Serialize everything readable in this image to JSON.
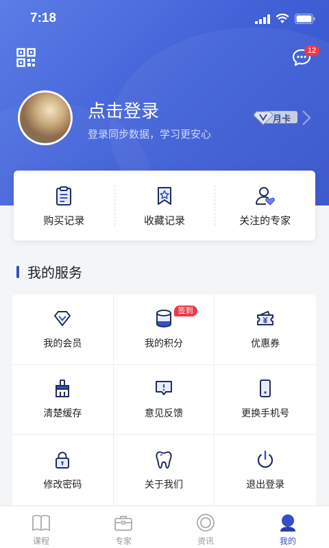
{
  "status_bar": {
    "time": "7:18"
  },
  "header": {
    "message_count": "12"
  },
  "profile": {
    "title": "点击登录",
    "subtitle": "登录同步数据，学习更安心",
    "vip_label": "月卡"
  },
  "quick_actions": [
    {
      "label": "购买记录",
      "icon": "clipboard-icon"
    },
    {
      "label": "收藏记录",
      "icon": "bookmark-star-icon"
    },
    {
      "label": "关注的专家",
      "icon": "user-heart-icon"
    }
  ],
  "services": {
    "title": "我的服务",
    "items": [
      {
        "label": "我的会员",
        "icon": "diamond-icon"
      },
      {
        "label": "我的积分",
        "icon": "coins-icon",
        "tag": "签到"
      },
      {
        "label": "优惠券",
        "icon": "coupon-icon"
      },
      {
        "label": "清楚缓存",
        "icon": "broom-icon"
      },
      {
        "label": "意见反馈",
        "icon": "feedback-icon"
      },
      {
        "label": "更换手机号",
        "icon": "phone-icon"
      },
      {
        "label": "修改密码",
        "icon": "lock-icon"
      },
      {
        "label": "关于我们",
        "icon": "tooth-icon"
      },
      {
        "label": "退出登录",
        "icon": "power-icon"
      }
    ]
  },
  "tabbar": [
    {
      "label": "课程",
      "icon": "book-icon",
      "active": false
    },
    {
      "label": "专家",
      "icon": "briefcase-icon",
      "active": false
    },
    {
      "label": "资讯",
      "icon": "news-icon",
      "active": false
    },
    {
      "label": "我的",
      "icon": "profile-icon",
      "active": true
    }
  ],
  "colors": {
    "primary": "#3550c8",
    "badge": "#f0384b",
    "hero_start": "#5b7de6",
    "hero_end": "#3452c9"
  }
}
